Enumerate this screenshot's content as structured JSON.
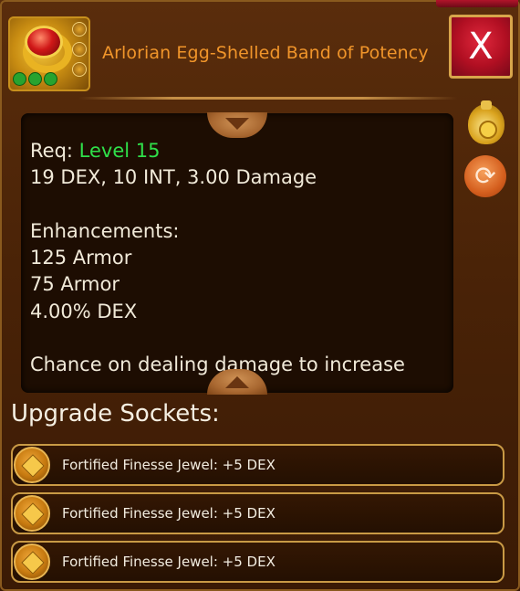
{
  "item": {
    "name": "Arlorian Egg-Shelled Band of Potency",
    "close_label": "X"
  },
  "description": {
    "lines": [
      {
        "prefix": "Req: ",
        "highlight": "Level 15"
      },
      {
        "text": "19 DEX, 10 INT, 3.00 Damage"
      },
      {
        "text": ""
      },
      {
        "text": "Enhancements:"
      },
      {
        "text": "125 Armor"
      },
      {
        "text": "75 Armor"
      },
      {
        "text": "4.00% DEX"
      },
      {
        "text": ""
      },
      {
        "text": "Chance on dealing damage to increase"
      }
    ]
  },
  "sockets": {
    "heading": "Upgrade Sockets:",
    "items": [
      {
        "label": "Fortified Finesse Jewel: +5 DEX"
      },
      {
        "label": "Fortified Finesse Jewel: +5 DEX"
      },
      {
        "label": "Fortified Finesse Jewel: +5 DEX"
      }
    ]
  },
  "colors": {
    "title": "#f0952a",
    "requirement_level": "#2fe04a",
    "close_button": "#b10f22",
    "panel_background": "#4a2307"
  },
  "icons": {
    "item": "gold-ring-red-gem-icon",
    "sell": "gold-pouch-icon",
    "swap": "swap-arrows-icon",
    "socket": "jewel-socket-icon"
  }
}
